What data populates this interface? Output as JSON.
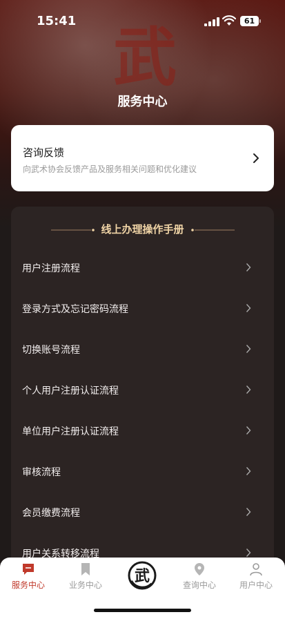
{
  "status_bar": {
    "time": "15:41",
    "battery": "61"
  },
  "hero": {
    "emblem_char": "武"
  },
  "header": {
    "title": "服务中心"
  },
  "consult": {
    "title": "咨询反馈",
    "subtitle": "向武术协会反馈产品及服务相关问题和优化建议"
  },
  "manual": {
    "title": "线上办理操作手册",
    "items": [
      {
        "label": "用户注册流程"
      },
      {
        "label": "登录方式及忘记密码流程"
      },
      {
        "label": "切换账号流程"
      },
      {
        "label": "个人用户注册认证流程"
      },
      {
        "label": "单位用户注册认证流程"
      },
      {
        "label": "审核流程"
      },
      {
        "label": "会员缴费流程"
      },
      {
        "label": "用户关系转移流程"
      }
    ]
  },
  "tabbar": {
    "items": [
      {
        "label": "服务中心",
        "icon": "message-icon",
        "active": true
      },
      {
        "label": "业务中心",
        "icon": "bookmark-icon",
        "active": false
      },
      {
        "label": "",
        "icon": "wu-logo-icon",
        "active": false
      },
      {
        "label": "查询中心",
        "icon": "location-pin-icon",
        "active": false
      },
      {
        "label": "用户中心",
        "icon": "user-icon",
        "active": false
      }
    ],
    "center_logo_char": "武"
  },
  "colors": {
    "accent": "#c0392b",
    "card_dark": "#2c2423",
    "manual_title": "#f0d4a6"
  }
}
